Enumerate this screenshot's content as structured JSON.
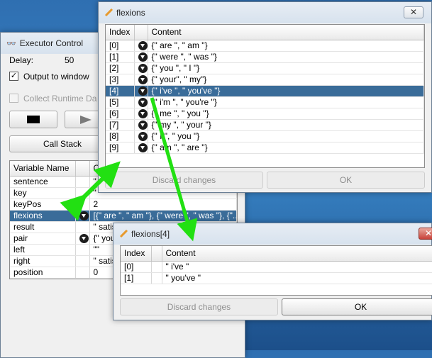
{
  "executor": {
    "title": "Executor Control",
    "delay_label": "Delay:",
    "delay_value": "50",
    "output_label": "Output to window",
    "collect_label": "Collect Runtime Da",
    "call_stack": "Call Stack",
    "columns": [
      "Variable Name",
      "C"
    ],
    "rows": [
      {
        "name": "sentence",
        "value": "\"",
        "dd": false,
        "selected": false
      },
      {
        "name": "key",
        "value": "\"",
        "dd": false,
        "selected": false
      },
      {
        "name": "keyPos",
        "value": "2",
        "dd": false,
        "selected": false
      },
      {
        "name": "flexions",
        "value": "[{\" are \", \" am \"}, {\" were \", \" was \"}, {\"...",
        "dd": true,
        "selected": true
      },
      {
        "name": "result",
        "value": "\" satis",
        "dd": false,
        "selected": false
      },
      {
        "name": "pair",
        "value": "{\" you",
        "dd": true,
        "selected": false
      },
      {
        "name": "left",
        "value": "\"\"",
        "dd": false,
        "selected": false
      },
      {
        "name": "right",
        "value": "\" satis",
        "dd": false,
        "selected": false
      },
      {
        "name": "position",
        "value": "0",
        "dd": false,
        "selected": false
      }
    ]
  },
  "flexions": {
    "title": "flexions",
    "close": "✕",
    "columns": [
      "Index",
      "",
      "Content"
    ],
    "rows": [
      {
        "index": "[0]",
        "content": "{\" are \", \" am \"}",
        "selected": false
      },
      {
        "index": "[1]",
        "content": "{\" were \", \" was \"}",
        "selected": false
      },
      {
        "index": "[2]",
        "content": "{\" you \", \" I \"}",
        "selected": false
      },
      {
        "index": "[3]",
        "content": "{\" your\", \" my\"}",
        "selected": false
      },
      {
        "index": "[4]",
        "content": "{\" i've \", \" you've \"}",
        "selected": true
      },
      {
        "index": "[5]",
        "content": "{\" i'm \", \" you're \"}",
        "selected": false
      },
      {
        "index": "[6]",
        "content": "{\" me \", \" you \"}",
        "selected": false
      },
      {
        "index": "[7]",
        "content": "{\" my \", \" your \"}",
        "selected": false
      },
      {
        "index": "[8]",
        "content": "{\" I \", \" you \"}",
        "selected": false
      },
      {
        "index": "[9]",
        "content": "{\" am \", \" are \"}",
        "selected": false
      }
    ],
    "discard": "Discard changes",
    "ok": "OK"
  },
  "flexions4": {
    "title": "flexions[4]",
    "close": "✕",
    "columns": [
      "Index",
      "",
      "Content"
    ],
    "rows": [
      {
        "index": "[0]",
        "content": "\" i've \""
      },
      {
        "index": "[1]",
        "content": "\" you've \""
      }
    ],
    "discard": "Discard changes",
    "ok": "OK"
  },
  "colors": {
    "selection": "#3a6c99",
    "arrow": "#22e012",
    "desktop": "#2f6fb1"
  },
  "icons": [
    "binoculars-icon",
    "pencil-icon",
    "dropdown-icon",
    "close-icon",
    "stop-icon",
    "play-icon"
  ]
}
